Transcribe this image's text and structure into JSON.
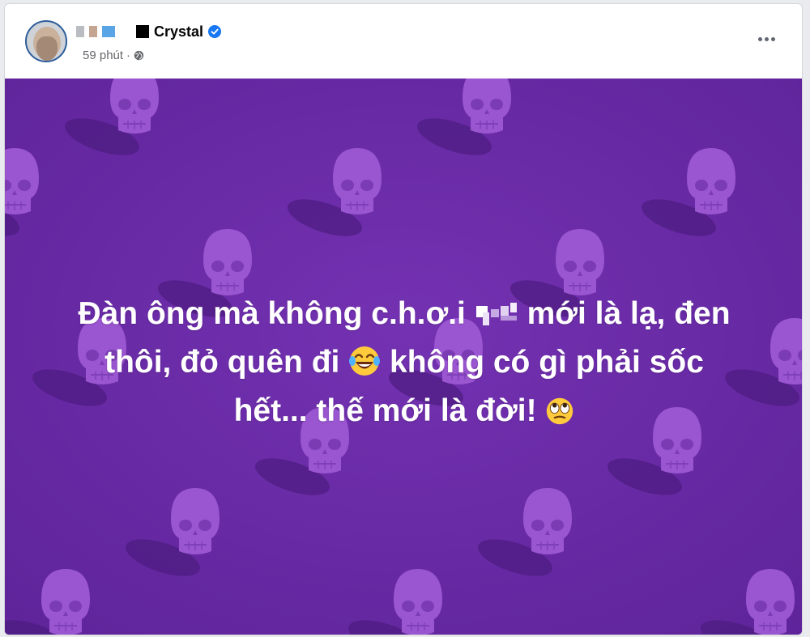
{
  "post": {
    "author_name": "Crystal",
    "timestamp": "59 phút",
    "separator": "·",
    "text_line1_a": "Đàn ông mà không c.h.ơ.i",
    "text_line1_b": "mới là lạ, đen",
    "text_line2_a": "thôi, đỏ quên đi",
    "text_line2_b": "không có gì phải sốc",
    "text_line3": "hết... thế mới là đời!"
  },
  "icons": {
    "verified": "verified-badge-icon",
    "audience": "globe-icon",
    "more": "more-options-icon",
    "laugh_emoji": "face-with-tears-of-joy-emoji",
    "eyes_emoji": "face-with-rolling-eyes-emoji"
  },
  "colors": {
    "background_purple": "#6a2aa8",
    "skull_purple": "#9a55d0",
    "verified_blue": "#1877f2",
    "text_white": "#ffffff"
  }
}
